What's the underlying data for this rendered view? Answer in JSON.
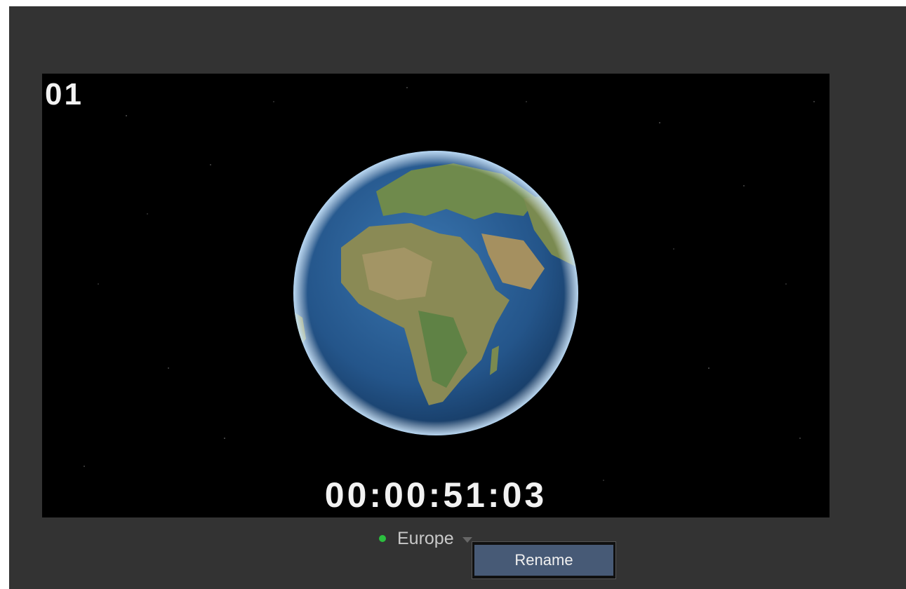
{
  "preview": {
    "clip_number": "01",
    "timecode": "00:00:51:03",
    "image": "earth-globe-africa"
  },
  "source": {
    "name": "Europe",
    "status": "active",
    "status_color": "#2bbf3f"
  },
  "context_menu": {
    "items": [
      {
        "label": "Rename"
      }
    ]
  },
  "colors": {
    "background": "#333333",
    "menu_highlight": "#475a76"
  }
}
